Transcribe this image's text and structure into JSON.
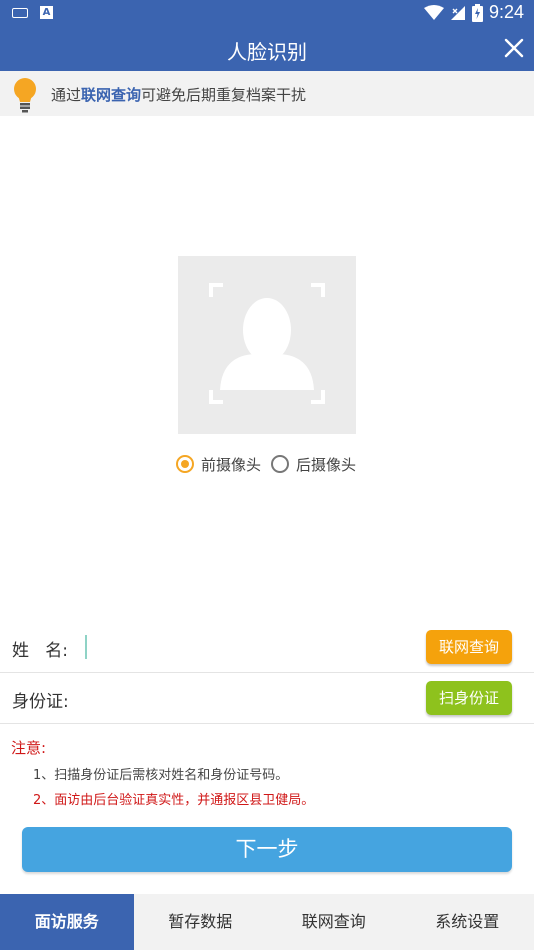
{
  "status_bar": {
    "time": "9:24",
    "keyboard_indicator": "A"
  },
  "header": {
    "title": "人脸识别"
  },
  "tip": {
    "prefix": "通过",
    "link": "联网查询",
    "suffix": "可避免后期重复档案干扰"
  },
  "camera": {
    "options": [
      {
        "label": "前摄像头",
        "selected": true
      },
      {
        "label": "后摄像头",
        "selected": false
      }
    ]
  },
  "form": {
    "name_label": "姓   名:",
    "name_value": "",
    "online_query_button": "联网查询",
    "id_label": "身份证:",
    "id_value": "",
    "scan_id_button": "扫身份证"
  },
  "notice": {
    "title": "注意:",
    "items": [
      "1、扫描身份证后需核对姓名和身份证号码。",
      "2、面访由后台验证真实性，并通报区县卫健局。"
    ]
  },
  "next_button": "下一步",
  "tabs": [
    {
      "label": "面访服务",
      "active": true
    },
    {
      "label": "暂存数据",
      "active": false
    },
    {
      "label": "联网查询",
      "active": false
    },
    {
      "label": "系统设置",
      "active": false
    }
  ],
  "colors": {
    "primary": "#3b64b0",
    "orange": "#f5a20c",
    "green": "#8ec21d",
    "next": "#45a4e0",
    "alert": "#d01818"
  }
}
